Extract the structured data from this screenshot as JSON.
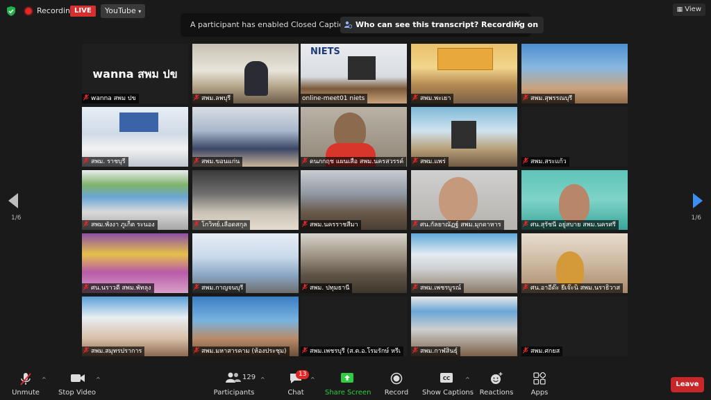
{
  "topbar": {
    "recording_label": "Recording",
    "live_label": "LIVE",
    "stream_target": "YouTube",
    "view_label": "View"
  },
  "banner": {
    "message": "A participant has enabled Closed Captioning",
    "link_label": "Who can see this transcript? Recording on"
  },
  "pagination": {
    "left": "1/6",
    "right": "1/6"
  },
  "tiles": [
    {
      "name": "wanna สพม ปข",
      "center_text": "wanna สพม ปข"
    },
    {
      "name": "สพม.ลพบุรี"
    },
    {
      "name": "online-meet01 niets"
    },
    {
      "name": "สพม.พะเยา"
    },
    {
      "name": "สพม.สุพรรณบุรี"
    },
    {
      "name": "สพม. ราชบุรี"
    },
    {
      "name": "สพม.ขอนแก่น"
    },
    {
      "name": "ดนภกฤช แผนเสือ สพม.นครสวรรค์"
    },
    {
      "name": "สพม.แพร่"
    },
    {
      "name": "สพม.สระแก้ว"
    },
    {
      "name": "สพม.พังงา ภูเก็ต ระนอง"
    },
    {
      "name": "โกวิทย์.เลือดสกุล"
    },
    {
      "name": "สพม.นครราชสีมา"
    },
    {
      "name": "ศน.กัลยาณัฏฐ์ สพม.มุกดาหาร"
    },
    {
      "name": "ศน.สุรัชนี อยู่สบาย สพม.นครศรี"
    },
    {
      "name": "ศน.นราวดี สพม.พัทลุง"
    },
    {
      "name": "สพม.กาญจนบุรี"
    },
    {
      "name": "สพม. ปทุมธานี"
    },
    {
      "name": "สพม.เพชรบูรณ์"
    },
    {
      "name": "ศน.อาอีด๊ะ ยีเจ๊ะนิ สพม.นราธิวาส"
    },
    {
      "name": "สพม.สมุทรปราการ"
    },
    {
      "name": "สพม.มหาสารคาม (ห้องประชุม)"
    },
    {
      "name": "สพม.เพชรบุรี (ส.ต.อ.โรมรักษ์ หรีเ"
    },
    {
      "name": "สพม.กาฬสินธุ์"
    },
    {
      "name": "สพม.ศกยส"
    }
  ],
  "toolbar": {
    "unmute": "Unmute",
    "stop_video": "Stop Video",
    "participants": "Participants",
    "participants_count": "129",
    "chat": "Chat",
    "chat_badge": "13",
    "share_screen": "Share Screen",
    "record": "Record",
    "show_captions": "Show Captions",
    "reactions": "Reactions",
    "apps": "Apps",
    "leave": "Leave"
  },
  "colors": {
    "live_red": "#d5302f",
    "active_speaker": "#9ad21e",
    "share_green": "#2ecc40",
    "leave_red": "#c8272a"
  }
}
